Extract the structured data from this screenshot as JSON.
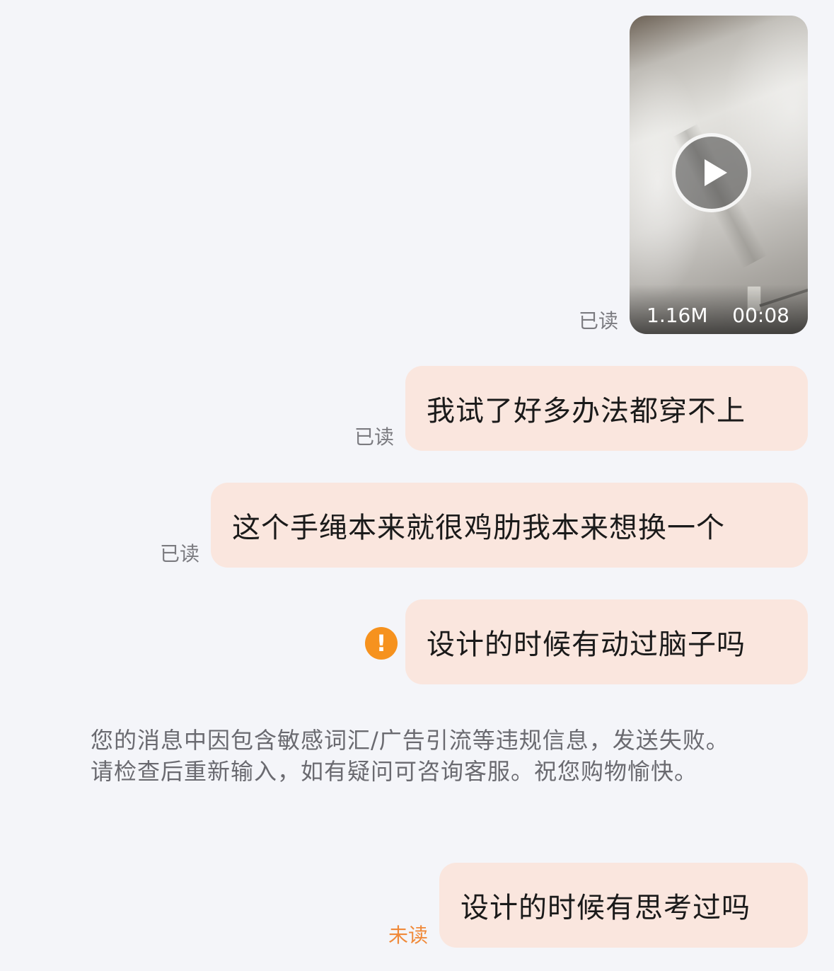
{
  "messages": [
    {
      "type": "video",
      "status": "已读",
      "file_size": "1.16M",
      "duration": "00:08",
      "icon": "play-icon"
    },
    {
      "type": "text",
      "text": "我试了好多办法都穿不上",
      "status": "已读"
    },
    {
      "type": "text",
      "text": "这个手绳本来就很鸡肋我本来想换一个",
      "status": "已读"
    },
    {
      "type": "text",
      "text": "设计的时候有动过脑子吗",
      "failed": true,
      "icon": "warning-icon",
      "icon_glyph": "!",
      "icon_color": "#f6921e"
    },
    {
      "type": "text",
      "text": "设计的时候有思考过吗",
      "status": "未读",
      "status_color": "#f08a3a"
    }
  ],
  "system_notice": "您的消息中因包含敏感词汇/广告引流等违规信息，发送失败。请检查后重新输入，如有疑问可咨询客服。祝您购物愉快。",
  "colors": {
    "background": "#f4f5f9",
    "bubble": "#fae6de",
    "status_text": "#7b7b80"
  }
}
